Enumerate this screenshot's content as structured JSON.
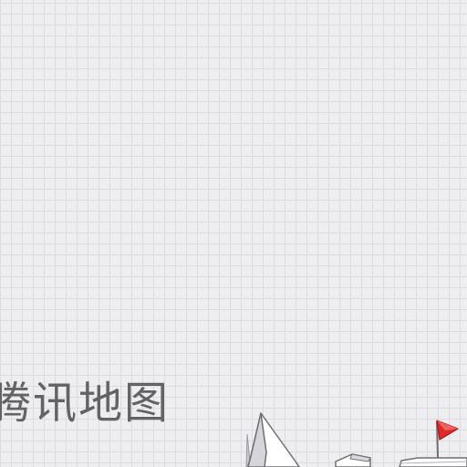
{
  "brand": {
    "text": "腾讯地图"
  },
  "illustration": {
    "icons": [
      "building-icon",
      "tower-icon",
      "flag-icon"
    ],
    "flag_color": "#e02a2a"
  },
  "colors": {
    "background": "#eeeef0",
    "grid_line": "#dcdce0",
    "brand_text": "#636366"
  }
}
